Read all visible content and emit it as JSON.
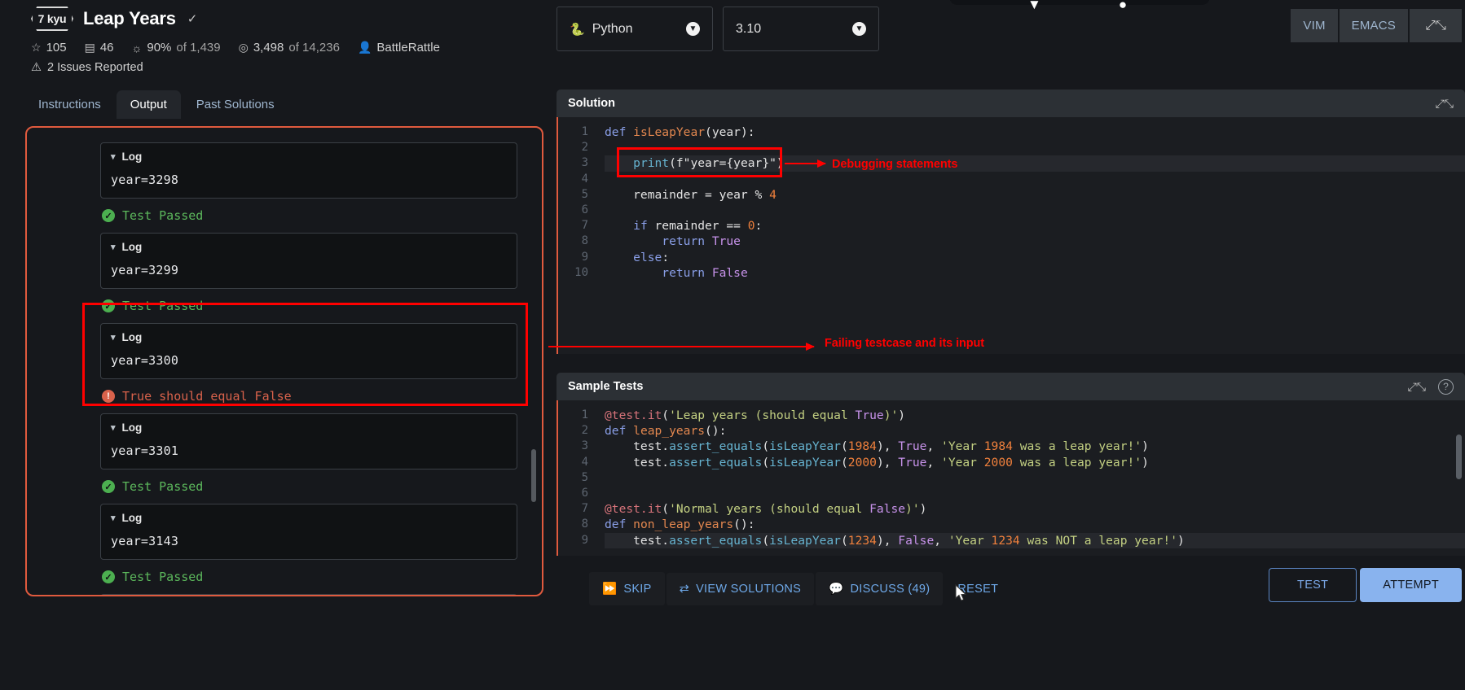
{
  "kata": {
    "rank": "7 kyu",
    "title": "Leap Years",
    "stats": {
      "stars": "105",
      "collections": "46",
      "satisfaction": "90%",
      "satisfaction_of": "of 1,439",
      "completed": "3,498",
      "completed_of": "of 14,236",
      "author": "BattleRattle"
    },
    "issues": "2 Issues Reported"
  },
  "tabs": [
    {
      "label": "Instructions",
      "active": false
    },
    {
      "label": "Output",
      "active": true
    },
    {
      "label": "Past Solutions",
      "active": false
    }
  ],
  "output": {
    "entries": [
      {
        "log_label": "Log",
        "log_value": "year=3298",
        "result": "Test Passed",
        "status": "pass"
      },
      {
        "log_label": "Log",
        "log_value": "year=3299",
        "result": "Test Passed",
        "status": "pass"
      },
      {
        "log_label": "Log",
        "log_value": "year=3300",
        "result": "True should equal False",
        "status": "fail"
      },
      {
        "log_label": "Log",
        "log_value": "year=3301",
        "result": "Test Passed",
        "status": "pass"
      },
      {
        "log_label": "Log",
        "log_value": "year=3143",
        "result": "Test Passed",
        "status": "pass"
      }
    ]
  },
  "annotations": [
    {
      "id": "debug",
      "text": "Debugging statements",
      "color": "#ff0000"
    },
    {
      "id": "failcase",
      "text": "Failing testcase and its input",
      "color": "#ff0000"
    }
  ],
  "toolbar": {
    "language": "Python",
    "version": "3.10",
    "vim_label": "VIM",
    "emacs_label": "EMACS"
  },
  "solution_panel": {
    "title": "Solution",
    "line_numbers": [
      "1",
      "2",
      "3",
      "4",
      "5",
      "6",
      "7",
      "8",
      "9",
      "10"
    ],
    "code_lines": [
      "def isLeapYear(year):",
      "",
      "    print(f\"year={year}\")",
      "",
      "    remainder = year % 4",
      "",
      "    if remainder == 0:",
      "        return True",
      "    else:",
      "        return False"
    ]
  },
  "tests_panel": {
    "title": "Sample Tests",
    "line_numbers": [
      "1",
      "2",
      "3",
      "4",
      "5",
      "6",
      "7",
      "8",
      "9"
    ],
    "code_lines": [
      "@test.it('Leap years (should equal True)')",
      "def leap_years():",
      "    test.assert_equals(isLeapYear(1984), True, 'Year 1984 was a leap year!')",
      "    test.assert_equals(isLeapYear(2000), True, 'Year 2000 was a leap year!')",
      "",
      "",
      "@test.it('Normal years (should equal False)')",
      "def non_leap_years():",
      "    test.assert_equals(isLeapYear(1234), False, 'Year 1234 was NOT a leap year!')"
    ]
  },
  "actions": {
    "skip": "SKIP",
    "view_solutions": "VIEW SOLUTIONS",
    "discuss": "DISCUSS (49)",
    "reset": "RESET",
    "test": "TEST",
    "attempt": "ATTEMPT"
  },
  "colors": {
    "accent_red": "#e05a3e",
    "annotation_red": "#ff0000",
    "pass_green": "#5cb85c",
    "fail_red": "#d9624b",
    "primary_blue": "#89b3ee"
  }
}
